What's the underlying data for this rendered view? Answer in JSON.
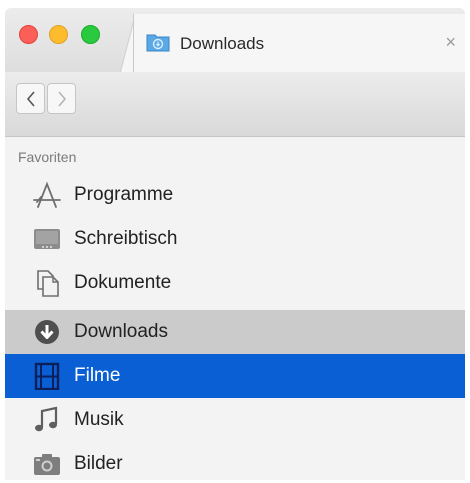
{
  "window": {
    "tab_title": "Downloads",
    "tab_close": "×"
  },
  "colors": {
    "selection": "#0a5fd5",
    "hover_row": "#cbcbcb",
    "sidebar_bg": "#f3f3f3"
  },
  "sidebar": {
    "section_title": "Favoriten",
    "items": [
      {
        "label": "Programme",
        "icon": "applications-icon"
      },
      {
        "label": "Schreibtisch",
        "icon": "desktop-icon"
      },
      {
        "label": "Dokumente",
        "icon": "documents-icon"
      },
      {
        "label": "Downloads",
        "icon": "downloads-icon",
        "state": "highlighted"
      },
      {
        "label": "Filme",
        "icon": "movies-icon",
        "state": "selected"
      },
      {
        "label": "Musik",
        "icon": "music-icon"
      },
      {
        "label": "Bilder",
        "icon": "pictures-icon"
      }
    ]
  }
}
